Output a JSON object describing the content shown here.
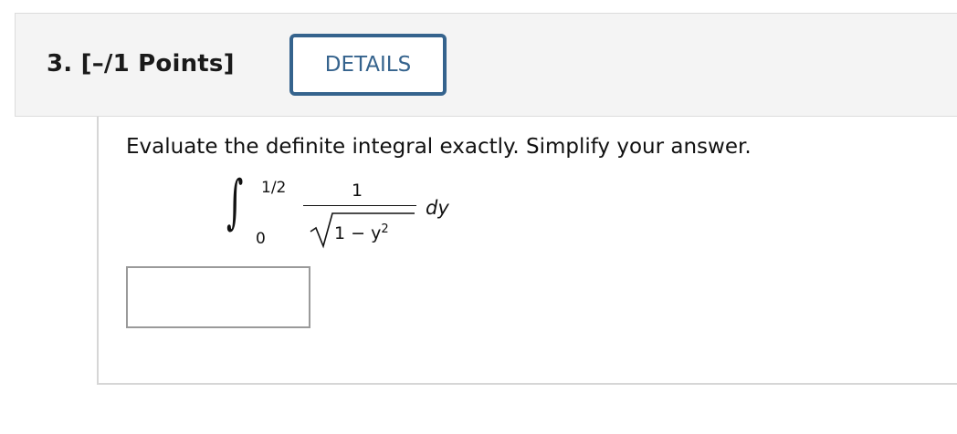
{
  "question": {
    "title": "3. [–/1 Points]",
    "details_label": "DETAILS",
    "prompt": "Evaluate the definite integral exactly. Simplify your answer.",
    "integral": {
      "upper_limit": "1/2",
      "lower_limit": "0",
      "numerator": "1",
      "radicand_base": "1 − y",
      "radicand_exponent": "2",
      "differential": "dy"
    },
    "answer": {
      "value": "",
      "placeholder": ""
    }
  },
  "colors": {
    "header_bg": "#f4f4f4",
    "button_border": "#35638d",
    "button_text": "#35638d",
    "text": "#111111"
  }
}
